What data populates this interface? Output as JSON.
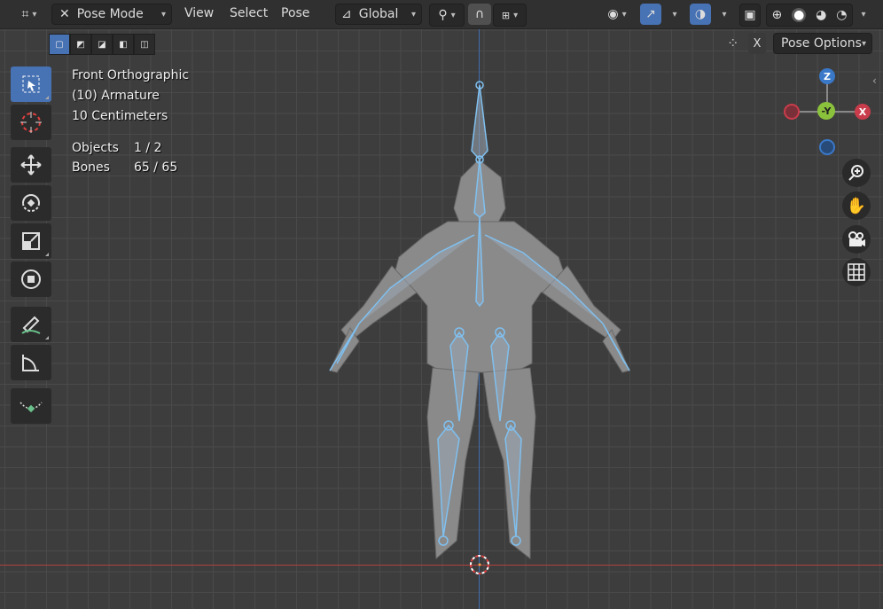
{
  "header": {
    "mode_label": "Pose Mode",
    "menus": [
      "View",
      "Select",
      "Pose"
    ],
    "orientation_label": "Global"
  },
  "toolbar2": {
    "x_label": "X",
    "pose_options_label": "Pose Options"
  },
  "overlay": {
    "view_name": "Front Orthographic",
    "object_name": "(10) Armature",
    "scale": "10 Centimeters",
    "objects_label": "Objects",
    "objects_value": "1 / 2",
    "bones_label": "Bones",
    "bones_value": "65 / 65"
  },
  "gizmo": {
    "z_label": "Z",
    "y_label": "-Y",
    "x_label": "X"
  },
  "colors": {
    "accent": "#4772b3",
    "bone": "#7fc0f0",
    "axis_x": "#c93c4b",
    "axis_y": "#8bc23c",
    "axis_z": "#3a78c8"
  },
  "icons": {
    "editor_type": "editor-type-icon",
    "mode": "pose-mode-icon",
    "tools": [
      "select-box-icon",
      "cursor-icon",
      "move-icon",
      "rotate-icon",
      "scale-icon",
      "transform-icon",
      "annotate-icon",
      "measure-icon",
      "bone-envelope-icon"
    ]
  }
}
